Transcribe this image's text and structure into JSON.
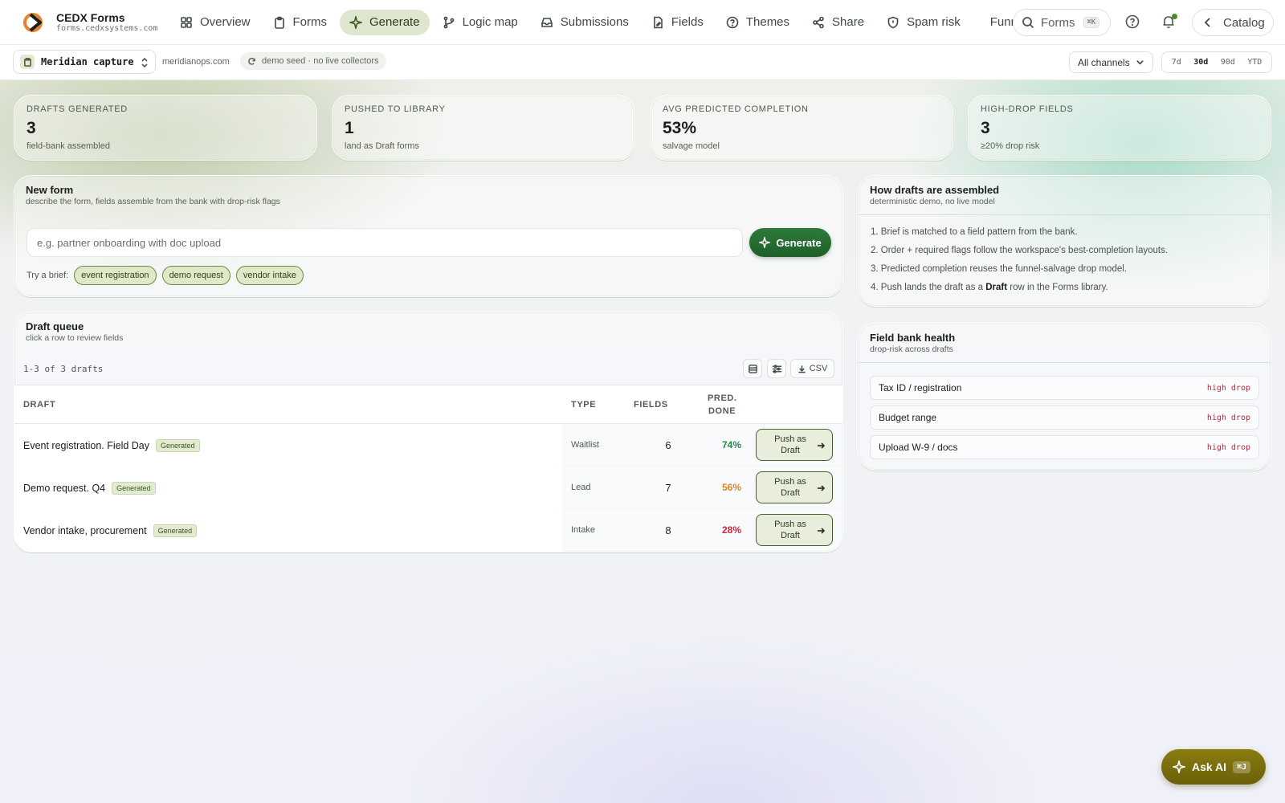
{
  "brand": {
    "name": "CEDX Forms",
    "domain": "forms.cedxsystems.com"
  },
  "nav": {
    "items": [
      {
        "label": "Overview",
        "icon": "grid-icon"
      },
      {
        "label": "Forms",
        "icon": "clipboard-icon"
      },
      {
        "label": "Generate",
        "icon": "sparkle-icon",
        "active": true
      },
      {
        "label": "Logic map",
        "icon": "branch-icon"
      },
      {
        "label": "Submissions",
        "icon": "inbox-icon"
      },
      {
        "label": "Fields",
        "icon": "file-edit-icon"
      },
      {
        "label": "Themes",
        "icon": "help-circle-icon"
      },
      {
        "label": "Share",
        "icon": "share-icon"
      },
      {
        "label": "Spam risk",
        "icon": "shield-icon"
      },
      {
        "label": "Funnel",
        "icon": "filter-icon"
      }
    ],
    "search_label": "Forms",
    "search_kbd": "⌘K",
    "catalog_label": "Catalog"
  },
  "subbar": {
    "workspace": "Meridian capture",
    "workspace_domain": "meridianops.com",
    "seed_label": "demo seed · no live collectors",
    "channel": "All channels",
    "ranges": [
      "7d",
      "30d",
      "90d",
      "YTD"
    ],
    "active_range": "30d"
  },
  "kpis": [
    {
      "label": "Drafts generated",
      "value": "3",
      "sub": "field-bank assembled"
    },
    {
      "label": "Pushed to library",
      "value": "1",
      "sub": "land as Draft forms"
    },
    {
      "label": "Avg predicted completion",
      "value": "53%",
      "sub": "salvage model"
    },
    {
      "label": "High-drop fields",
      "value": "3",
      "sub": "≥20% drop risk"
    }
  ],
  "new_form": {
    "title": "New form",
    "subtitle": "describe the form, fields assemble from the bank with drop-risk flags",
    "placeholder": "e.g. partner onboarding with doc upload",
    "input_value": "",
    "generate_label": "Generate",
    "try_label": "Try a brief:",
    "briefs": [
      "event registration",
      "demo request",
      "vendor intake"
    ]
  },
  "queue": {
    "title": "Draft queue",
    "subtitle": "click a row to review fields",
    "count": "1-3 of 3 drafts",
    "csv_label": "CSV",
    "columns": {
      "draft": "Draft",
      "type": "Type",
      "fields": "Fields",
      "pred": "Pred.",
      "pred2": "Done"
    },
    "rows": [
      {
        "name": "Event registration. Field Day",
        "badge": "Generated",
        "type": "Waitlist",
        "fields": "6",
        "pred": "74%",
        "pred_color": "#1f8a4c",
        "action_1": "Push as",
        "action_2": "Draft"
      },
      {
        "name": "Demo request. Q4",
        "badge": "Generated",
        "type": "Lead",
        "fields": "7",
        "pred": "56%",
        "pred_color": "#d9822b",
        "action_1": "Push as",
        "action_2": "Draft"
      },
      {
        "name": "Vendor intake, procurement",
        "badge": "Generated",
        "type": "Intake",
        "fields": "8",
        "pred": "28%",
        "pred_color": "#d0263e",
        "action_1": "Push as",
        "action_2": "Draft"
      }
    ]
  },
  "howto": {
    "title": "How drafts are assembled",
    "subtitle": "deterministic demo, no live model",
    "steps": [
      {
        "pre": "1. Brief is matched to a field pattern from the bank.",
        "bold": "",
        "post": ""
      },
      {
        "pre": "2. Order + required flags follow the workspace's best-completion layouts.",
        "bold": "",
        "post": ""
      },
      {
        "pre": "3. Predicted completion reuses the funnel-salvage drop model.",
        "bold": "",
        "post": ""
      },
      {
        "pre": "4. Push lands the draft as a ",
        "bold": "Draft",
        "post": " row in the Forms library."
      }
    ]
  },
  "bank": {
    "title": "Field bank health",
    "subtitle": "drop-risk across drafts",
    "rows": [
      {
        "label": "Tax ID / registration",
        "tag": "high drop"
      },
      {
        "label": "Budget range",
        "tag": "high drop"
      },
      {
        "label": "Upload W-9 / docs",
        "tag": "high drop"
      }
    ]
  },
  "ask_ai": {
    "label": "Ask AI",
    "kbd": "⌘J"
  }
}
